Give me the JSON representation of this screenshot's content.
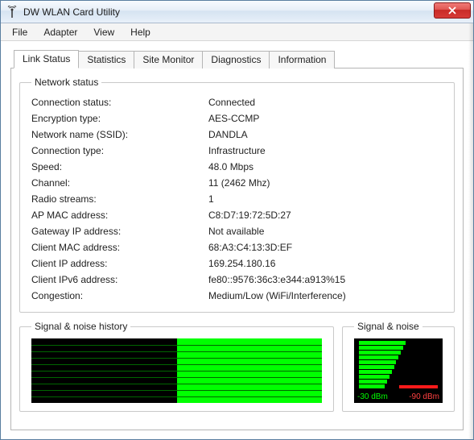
{
  "window": {
    "title": "DW WLAN Card Utility"
  },
  "menu": {
    "file": "File",
    "adapter": "Adapter",
    "view": "View",
    "help": "Help"
  },
  "tabs": {
    "link_status": "Link Status",
    "statistics": "Statistics",
    "site_monitor": "Site Monitor",
    "diagnostics": "Diagnostics",
    "information": "Information"
  },
  "network_status": {
    "legend": "Network status",
    "rows": {
      "connection_status": {
        "label": "Connection status:",
        "value": "Connected"
      },
      "encryption_type": {
        "label": "Encryption type:",
        "value": "AES-CCMP"
      },
      "network_name": {
        "label": "Network name (SSID):",
        "value": "DANDLA"
      },
      "connection_type": {
        "label": "Connection type:",
        "value": "Infrastructure"
      },
      "speed": {
        "label": "Speed:",
        "value": "48.0 Mbps"
      },
      "channel": {
        "label": "Channel:",
        "value": "11 (2462 Mhz)"
      },
      "radio_streams": {
        "label": "Radio streams:",
        "value": "1"
      },
      "ap_mac": {
        "label": "AP MAC address:",
        "value": "C8:D7:19:72:5D:27"
      },
      "gateway_ip": {
        "label": "Gateway IP address:",
        "value": "Not available"
      },
      "client_mac": {
        "label": "Client MAC address:",
        "value": "68:A3:C4:13:3D:EF"
      },
      "client_ip": {
        "label": "Client IP address:",
        "value": "169.254.180.16"
      },
      "client_ipv6": {
        "label": "Client IPv6 address:",
        "value": "fe80::9576:36c3:e344:a913%15"
      },
      "congestion": {
        "label": "Congestion:",
        "value": "Medium/Low (WiFi/Interference)"
      }
    }
  },
  "history": {
    "legend": "Signal & noise history"
  },
  "signal_noise": {
    "legend": "Signal & noise",
    "signal_label": "-30 dBm",
    "noise_label": "-90 dBm"
  }
}
